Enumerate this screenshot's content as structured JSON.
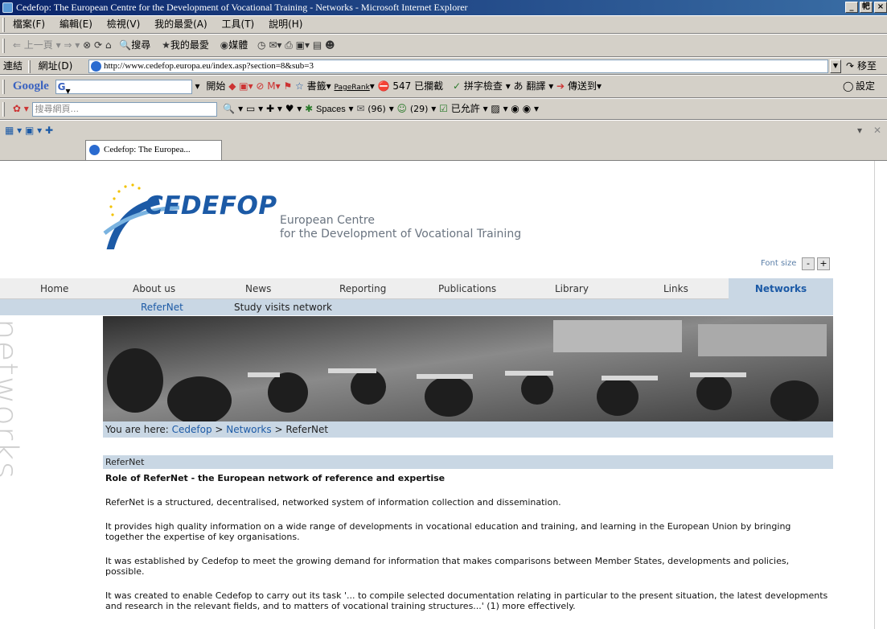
{
  "window": {
    "title": "Cedefop: The European Centre for the Development of Vocational Training - Networks - Microsoft Internet Explorer",
    "buttons": [
      "_",
      "帊",
      "×"
    ]
  },
  "menu": [
    "檔案(F)",
    "編輯(E)",
    "檢視(V)",
    "我的最愛(A)",
    "工具(T)",
    "說明(H)"
  ],
  "toolbar": {
    "back": "上一頁",
    "search": "搜尋",
    "favorites": "我的最愛",
    "media": "媒體"
  },
  "address": {
    "links_label": "連結",
    "label": "網址(D)",
    "url": "http://www.cedefop.europa.eu/index.asp?section=8&sub=3",
    "go": "移至"
  },
  "googlebar": {
    "brand": "Google",
    "g": "G",
    "start": "開始",
    "bookmarks": "書籤",
    "pagerank": "PageRank",
    "blocked": "547 已攔截",
    "spell": "拼字檢查",
    "translate": "翻譯",
    "send": "傳送到",
    "settings": "設定"
  },
  "searchbar": {
    "placeholder": "搜尋網頁...",
    "spaces": "Spaces",
    "mail": "(96)",
    "contacts": "(29)",
    "allowed": "已允許"
  },
  "tab": {
    "label": "Cedefop: The Europea..."
  },
  "page": {
    "logo": "CEDEFOP",
    "tagline_1": "European Centre",
    "tagline_2": "for the Development of Vocational Training",
    "font_size_label": "Font size",
    "font_minus": "-",
    "font_plus": "+",
    "nav": [
      "Home",
      "About us",
      "News",
      "Reporting",
      "Publications",
      "Library",
      "Links",
      "Networks"
    ],
    "subnav": [
      "ReferNet",
      "Study visits network"
    ],
    "side_label": "networks",
    "breadcrumb": {
      "prefix": "You are here: ",
      "crumb1": "Cedefop",
      "sep1": " > ",
      "crumb2": "Networks",
      "sep2": " > ",
      "current": "ReferNet"
    },
    "section_title": "ReferNet",
    "heading": "Role of ReferNet - the European network of reference and expertise",
    "paragraphs": [
      "ReferNet is a structured, decentralised, networked system of information collection and dissemination.",
      "It provides high quality information on a wide range of developments in vocational education and training, and learning in the European Union by bringing together the expertise of key organisations.",
      "It was established by Cedefop to meet the growing demand for information that makes comparisons between Member States, developments and policies, possible.",
      "It was created to enable Cedefop to carry out its task '... to compile selected documentation relating in particular to the present situation, the latest developments and research in the relevant fields, and to matters of vocational training structures...' (1) more effectively."
    ]
  }
}
